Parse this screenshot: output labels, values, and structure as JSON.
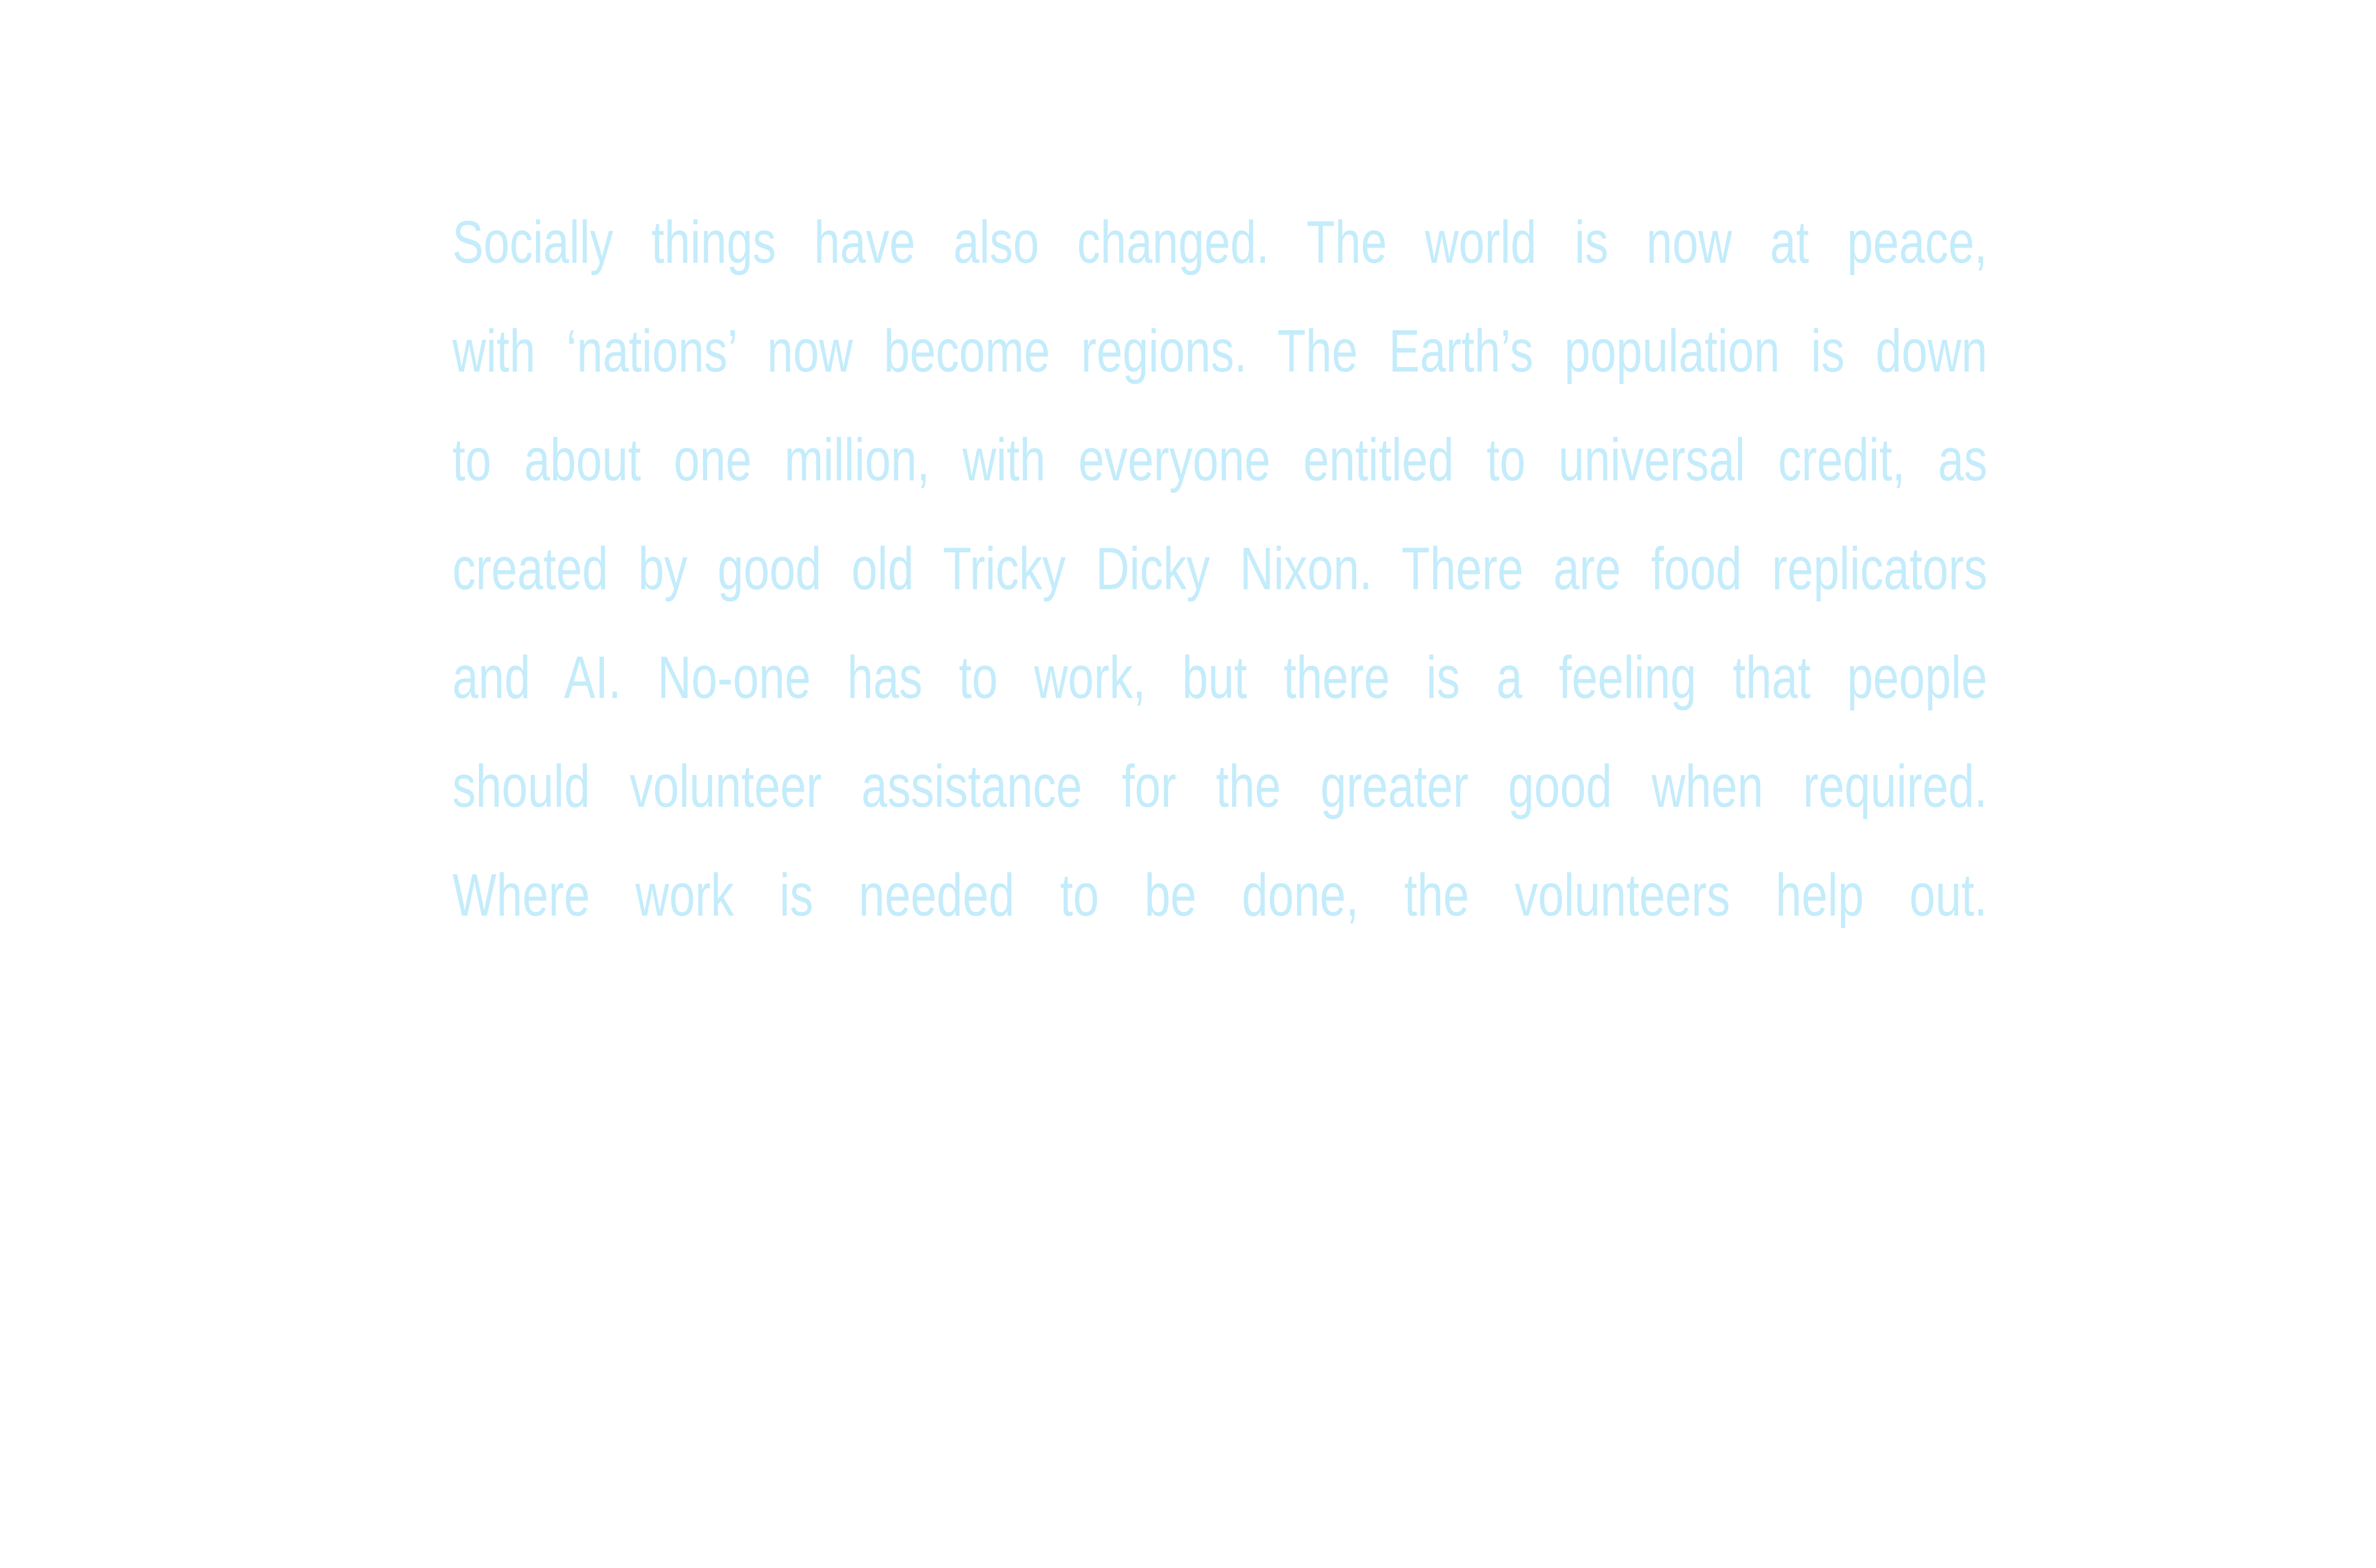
{
  "document": {
    "paragraph_lines": [
      "Socially things have also changed. The world is now at peace,",
      "with ‘nations’ now become regions. The Earth’s population is down",
      "to about one million, with everyone entitled to universal credit, as",
      "created by good old Tricky Dicky Nixon. There are food replicators",
      "and AI. No-one has to work, but there is a feeling that people",
      "should volunteer assistance for the greater good when required.",
      "Where work is needed to be done, the volunteers help out."
    ]
  },
  "colors": {
    "background": "#ffffff",
    "text": "#c4ecfb"
  }
}
